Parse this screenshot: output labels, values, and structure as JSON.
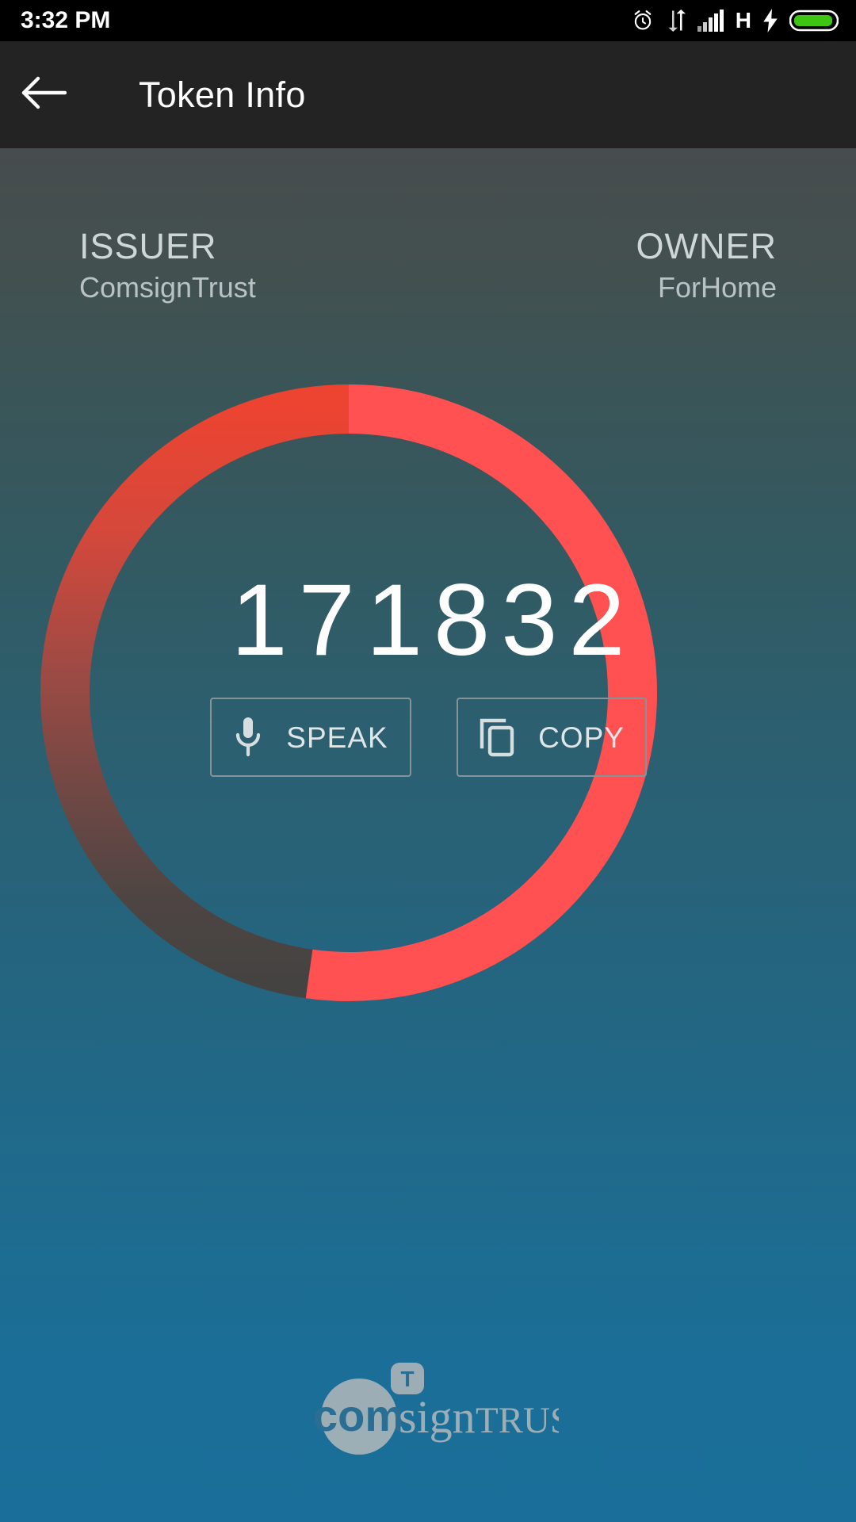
{
  "status_bar": {
    "time": "3:32 PM",
    "network_type": "H",
    "icons": [
      "alarm-icon",
      "data-transfer-icon",
      "signal-bars-icon",
      "network-type-label",
      "charging-bolt-icon",
      "battery-icon"
    ],
    "battery_color": "#3ec513"
  },
  "app_bar": {
    "title": "Token Info",
    "back_icon": "back-arrow-icon",
    "background": "#232323"
  },
  "token": {
    "issuer_label": "ISSUER",
    "issuer_value": "ComsignTrust",
    "owner_label": "OWNER",
    "owner_value": "ForHome",
    "code": "171832"
  },
  "progress_ring": {
    "track_color_top": "#e8422f",
    "track_color_bottom": "#474442",
    "progress_color": "#ff5151",
    "progress_percent": 52,
    "start_angle_deg": 0,
    "sweep_deg": 188
  },
  "actions": {
    "speak_label": "SPEAK",
    "speak_icon": "microphone-icon",
    "copy_label": "COPY",
    "copy_icon": "copy-icon",
    "border_color": "#86949a"
  },
  "brand": {
    "name": "comsignTRUST",
    "part_com": "com",
    "part_sign": "sign",
    "part_trust": "TRUST",
    "badge_letter": "T",
    "color": "#b9bcbd"
  },
  "theme": {
    "background_top": "#474c4e",
    "background_bottom": "#1a6f9a",
    "text_primary": "#ffffff",
    "text_secondary": "#cfd6d8"
  }
}
